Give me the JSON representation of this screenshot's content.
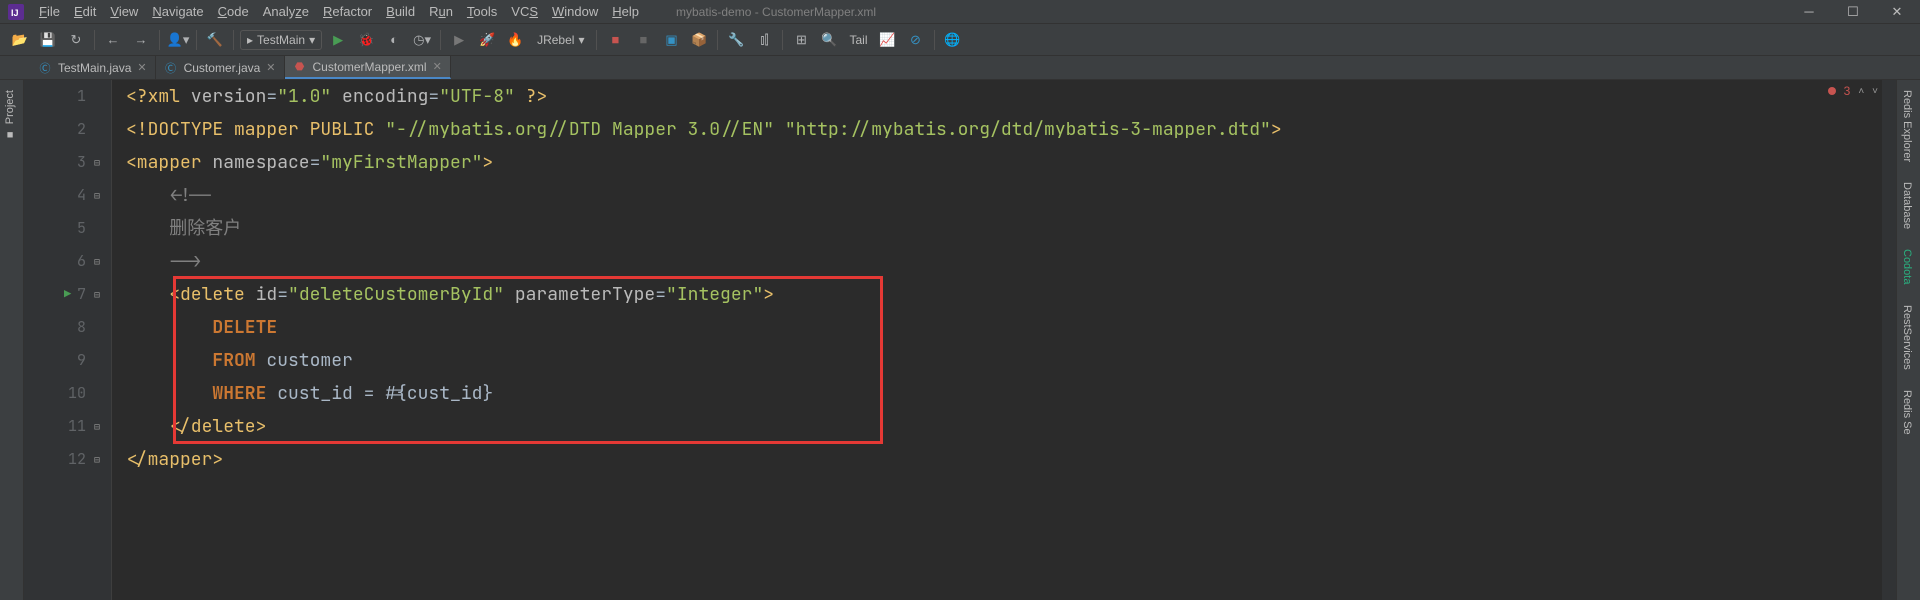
{
  "menu": {
    "items": [
      "File",
      "Edit",
      "View",
      "Navigate",
      "Code",
      "Analyze",
      "Refactor",
      "Build",
      "Run",
      "Tools",
      "VCS",
      "Window",
      "Help"
    ]
  },
  "window": {
    "title": "mybatis-demo - CustomerMapper.xml"
  },
  "toolbar": {
    "run_config": "TestMain",
    "jrebel": "JRebel",
    "tail": "Tail"
  },
  "tabs": [
    {
      "label": "TestMain.java",
      "icon": "class",
      "active": false
    },
    {
      "label": "Customer.java",
      "icon": "class",
      "active": false
    },
    {
      "label": "CustomerMapper.xml",
      "icon": "mapper",
      "active": true
    }
  ],
  "sidebar_left": {
    "project": "Project"
  },
  "sidebar_right": {
    "items": [
      "Redis Explorer",
      "Database",
      "Codota",
      "RestServices",
      "Redis Se"
    ]
  },
  "editor": {
    "error_count": "3",
    "lines": [
      {
        "n": "1"
      },
      {
        "n": "2"
      },
      {
        "n": "3"
      },
      {
        "n": "4"
      },
      {
        "n": "5"
      },
      {
        "n": "6"
      },
      {
        "n": "7"
      },
      {
        "n": "8"
      },
      {
        "n": "9"
      },
      {
        "n": "10"
      },
      {
        "n": "11"
      },
      {
        "n": "12"
      }
    ],
    "code": {
      "l1_xml": "<?xml",
      "l1_attr1": " version",
      "l1_eq": "=",
      "l1_v1": "\"1.0\"",
      "l1_attr2": " encoding",
      "l1_v2": "\"UTF-8\"",
      "l1_close": " ?>",
      "l2_doctype": "<!DOCTYPE ",
      "l2_mapper": "mapper ",
      "l2_public": "PUBLIC ",
      "l2_s1": "\"-//mybatis.org//DTD Mapper 3.0//EN\"",
      "l2_s2": " \"http://mybatis.org/dtd/mybatis-3-mapper.dtd\"",
      "l2_close": ">",
      "l3_open": "<mapper",
      "l3_attr": " namespace",
      "l3_eq": "=",
      "l3_val": "\"myFirstMapper\"",
      "l3_close": ">",
      "l4_comment": "    <!--",
      "l5_comment": "    删除客户",
      "l6_comment": "    -->",
      "l7_open": "    <delete",
      "l7_attr1": " id",
      "l7_eq": "=",
      "l7_v1": "\"deleteCustomerById\"",
      "l7_attr2": " parameterType",
      "l7_v2": "\"Integer\"",
      "l7_close": ">",
      "l8_kw": "DELETE",
      "l9_kw": "FROM",
      "l9_txt": " customer",
      "l10_kw": "WHERE",
      "l10_txt": " cust_id = #{cust_id}",
      "l11_close": "    </delete>",
      "l12_close": "</mapper>"
    }
  }
}
